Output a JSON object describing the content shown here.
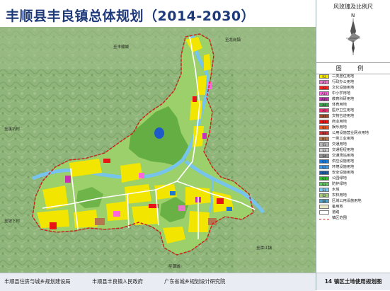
{
  "title": "丰顺县丰良镇总体规划（2014-2030）",
  "compass_title": "风玫瑰及比例尺",
  "compass_north": "N",
  "legend_title": "图  例",
  "legend": [
    {
      "code": "R2",
      "label": "二类居住用地",
      "color": "#f5e600"
    },
    {
      "code": "A1",
      "label": "行政办公用地",
      "color": "#e678c8"
    },
    {
      "code": "A2",
      "label": "文化设施用地",
      "color": "#ff2020"
    },
    {
      "code": "A33",
      "label": "中小学用地",
      "color": "#ff66d9"
    },
    {
      "code": "A35",
      "label": "教育科研用地",
      "color": "#c830b4"
    },
    {
      "code": "A4",
      "label": "体育用地",
      "color": "#3aa04a"
    },
    {
      "code": "A5",
      "label": "医疗卫生用地",
      "color": "#e83070"
    },
    {
      "code": "A7",
      "label": "文物古迹用地",
      "color": "#a04a28"
    },
    {
      "code": "B1",
      "label": "商业用地",
      "color": "#e81414"
    },
    {
      "code": "B3",
      "label": "娱乐用地",
      "color": "#e8501e"
    },
    {
      "code": "B4",
      "label": "公用设施营业网点用地",
      "color": "#c83232"
    },
    {
      "code": "M1",
      "label": "一类工业用地",
      "color": "#b47850"
    },
    {
      "code": "S1",
      "label": "交通用地",
      "color": "#b4b4b4"
    },
    {
      "code": "S3",
      "label": "交通枢纽用地",
      "color": "#d2d2d2"
    },
    {
      "code": "S4",
      "label": "交通场站用地",
      "color": "#909090"
    },
    {
      "code": "U1",
      "label": "供应设施用地",
      "color": "#1e78d2"
    },
    {
      "code": "U2",
      "label": "环境设施用地",
      "color": "#3c96e6"
    },
    {
      "code": "U3",
      "label": "安全设施用地",
      "color": "#1e5aa0"
    },
    {
      "code": "G1",
      "label": "公园绿地",
      "color": "#32b432"
    },
    {
      "code": "G2",
      "label": "防护绿地",
      "color": "#64c864"
    },
    {
      "code": "E1",
      "label": "水域",
      "color": "#7ec8f0"
    },
    {
      "code": "E2",
      "label": "农林用地",
      "color": "#a0c878"
    },
    {
      "code": "E9",
      "label": "区域公用设施用地",
      "color": "#50a0c8"
    },
    {
      "code": "",
      "label": "备用地",
      "color": "#e8e8c8"
    },
    {
      "code": "",
      "label": "道路",
      "color": "#ffffff"
    },
    {
      "code": "",
      "label": "镇区范围",
      "color": "#d02020",
      "dashed": true
    }
  ],
  "map_labels": {
    "north1": "至丰顺城",
    "north2": "至龙岗镇",
    "west1": "至溪坑村",
    "west2": "至坡下村",
    "south1": "至潭江镇",
    "south2": "至潮城"
  },
  "footer": {
    "org1": "丰顺县住房与城乡规划建设局",
    "org2": "丰顺县丰良镇人民政府",
    "org3": "广东省城乡规划设计研究院"
  },
  "sheet": "14  镇区土地使用规划图"
}
